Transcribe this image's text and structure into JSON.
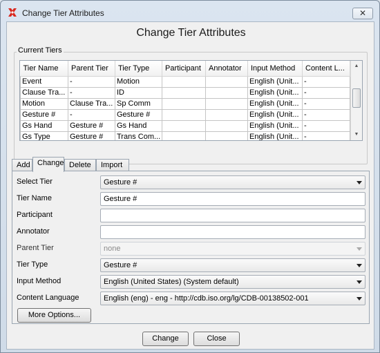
{
  "window": {
    "title": "Change Tier Attributes",
    "close_label": "✕"
  },
  "heading": "Change Tier Attributes",
  "current_tiers": {
    "label": "Current Tiers",
    "columns": [
      "Tier Name",
      "Parent Tier",
      "Tier Type",
      "Participant",
      "Annotator",
      "Input Method",
      "Content L..."
    ],
    "rows": [
      [
        "Event",
        "-",
        "Motion",
        "",
        "",
        "English (Unit...",
        "-"
      ],
      [
        "Clause Tra...",
        "-",
        "ID",
        "",
        "",
        "English (Unit...",
        "-"
      ],
      [
        "Motion",
        "Clause Tra...",
        "Sp Comm",
        "",
        "",
        "English (Unit...",
        "-"
      ],
      [
        "Gesture #",
        "-",
        "Gesture #",
        "",
        "",
        "English (Unit...",
        "-"
      ],
      [
        "Gs Hand",
        "Gesture #",
        "Gs Hand",
        "",
        "",
        "English (Unit...",
        "-"
      ],
      [
        "Gs Type",
        "Gesture #",
        "Trans Com...",
        "",
        "",
        "English (Unit...",
        "-"
      ]
    ]
  },
  "tabs": [
    "Add",
    "Change",
    "Delete",
    "Import"
  ],
  "form": {
    "select_tier_label": "Select Tier",
    "select_tier_value": "Gesture #",
    "tier_name_label": "Tier Name",
    "tier_name_value": "Gesture #",
    "participant_label": "Participant",
    "participant_value": "",
    "annotator_label": "Annotator",
    "annotator_value": "",
    "parent_tier_label": "Parent Tier",
    "parent_tier_value": "none",
    "tier_type_label": "Tier Type",
    "tier_type_value": "Gesture #",
    "input_method_label": "Input Method",
    "input_method_value": "English (United States) (System default)",
    "content_language_label": "Content Language",
    "content_language_value": "English (eng) - eng - http://cdb.iso.org/lg/CDB-00138502-001",
    "more_options_label": "More Options..."
  },
  "buttons": {
    "change_label": "Change",
    "close_label": "Close"
  },
  "colors": {
    "window_frame": "#dbe5f0",
    "client_bg": "#f0f0f0",
    "icon_red": "#d9281e"
  },
  "icons": {
    "app": "elan-app-icon",
    "close": "close-icon",
    "dropdown": "chevron-down-icon"
  }
}
